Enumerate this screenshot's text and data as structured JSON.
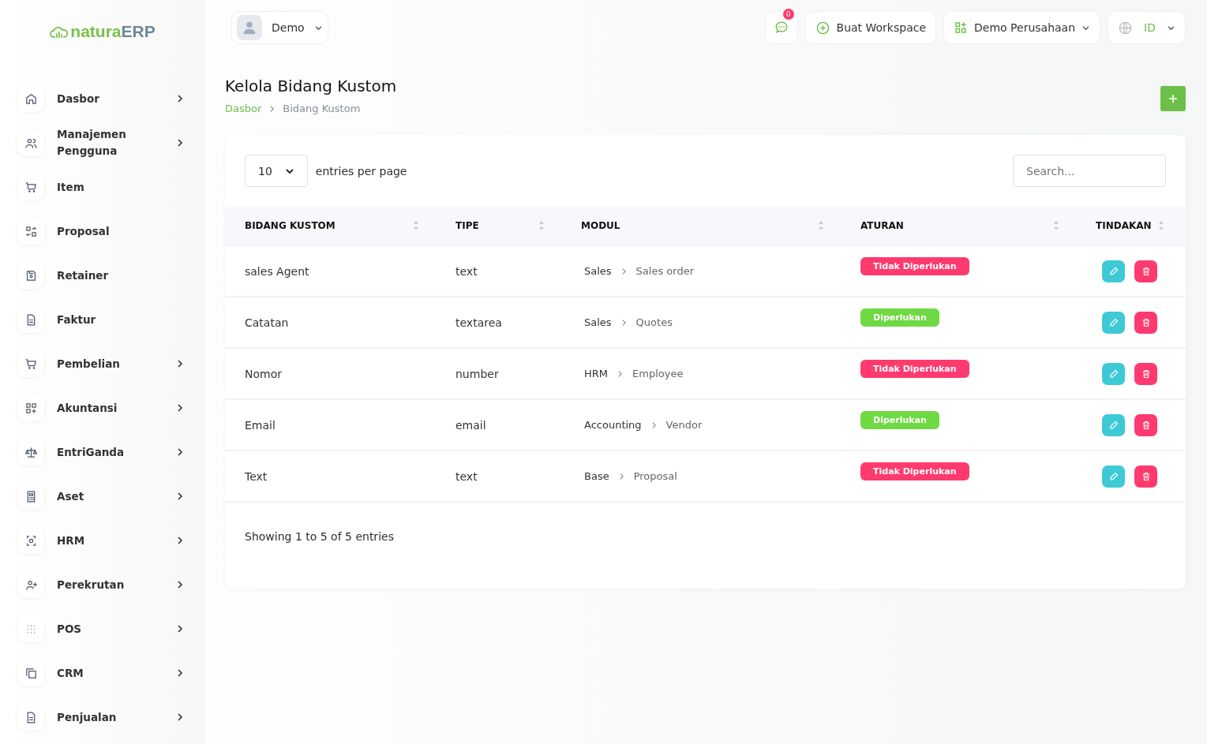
{
  "logo": {
    "brand": "natura",
    "suffix": "ERP"
  },
  "sidebar": {
    "items": [
      {
        "label": "Dasbor",
        "has_submenu": true
      },
      {
        "label": "Manajemen Pengguna",
        "has_submenu": true
      },
      {
        "label": "Item",
        "has_submenu": false
      },
      {
        "label": "Proposal",
        "has_submenu": false
      },
      {
        "label": "Retainer",
        "has_submenu": false
      },
      {
        "label": "Faktur",
        "has_submenu": false
      },
      {
        "label": "Pembelian",
        "has_submenu": true
      },
      {
        "label": "Akuntansi",
        "has_submenu": true
      },
      {
        "label": "EntriGanda",
        "has_submenu": true
      },
      {
        "label": "Aset",
        "has_submenu": true
      },
      {
        "label": "HRM",
        "has_submenu": true
      },
      {
        "label": "Perekrutan",
        "has_submenu": true
      },
      {
        "label": "POS",
        "has_submenu": true
      },
      {
        "label": "CRM",
        "has_submenu": true
      },
      {
        "label": "Penjualan",
        "has_submenu": true
      }
    ]
  },
  "topbar": {
    "user": "Demo",
    "notification_count": "0",
    "create_workspace": "Buat Workspace",
    "company": "Demo Perusahaan",
    "language": "ID"
  },
  "page": {
    "title": "Kelola Bidang Kustom",
    "breadcrumbs": [
      "Dasbor",
      "Bidang Kustom"
    ]
  },
  "table": {
    "page_size": "10",
    "page_size_label": "entries per page",
    "search": {
      "placeholder": "Search..."
    },
    "columns": [
      "BIDANG KUSTOM",
      "TIPE",
      "MODUL",
      "ATURAN",
      "TINDAKAN"
    ],
    "rows": [
      {
        "field": "sales Agent",
        "type": "text",
        "module": "Sales",
        "submodule": "Sales order",
        "rule": "Tidak Diperlukan",
        "required": false
      },
      {
        "field": "Catatan",
        "type": "textarea",
        "module": "Sales",
        "submodule": "Quotes",
        "rule": "Diperlukan",
        "required": true
      },
      {
        "field": "Nomor",
        "type": "number",
        "module": "HRM",
        "submodule": "Employee",
        "rule": "Tidak Diperlukan",
        "required": false
      },
      {
        "field": "Email",
        "type": "email",
        "module": "Accounting",
        "submodule": "Vendor",
        "rule": "Diperlukan",
        "required": true
      },
      {
        "field": "Text",
        "type": "text",
        "module": "Base",
        "submodule": "Proposal",
        "rule": "Tidak Diperlukan",
        "required": false
      }
    ],
    "footer": "Showing 1 to 5 of 5 entries"
  }
}
